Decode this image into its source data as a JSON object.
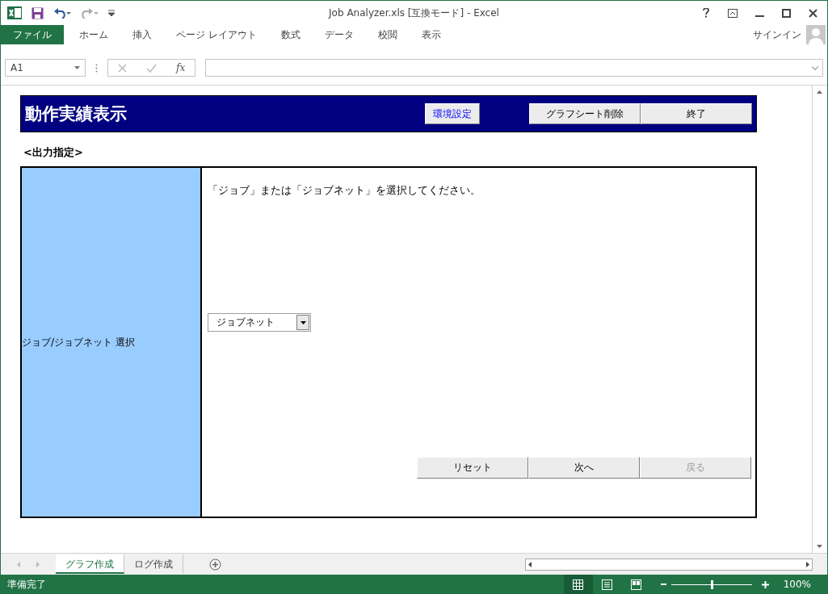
{
  "window": {
    "title": "Job Analyzer.xls  [互換モード] - Excel"
  },
  "ribbon_tabs": [
    {
      "label": "ファイル",
      "kind": "file",
      "selected": false
    },
    {
      "label": "ホーム",
      "kind": "tab",
      "selected": false
    },
    {
      "label": "挿入",
      "kind": "tab",
      "selected": false
    },
    {
      "label": "ページ レイアウト",
      "kind": "tab",
      "selected": false
    },
    {
      "label": "数式",
      "kind": "tab",
      "selected": false
    },
    {
      "label": "データ",
      "kind": "tab",
      "selected": false
    },
    {
      "label": "校閲",
      "kind": "tab",
      "selected": false
    },
    {
      "label": "表示",
      "kind": "tab",
      "selected": false
    }
  ],
  "account": {
    "label": "サインイン"
  },
  "formula_bar": {
    "name_box": "A1",
    "function_label": "fx"
  },
  "sheet": {
    "header": {
      "title": "動作実績表示",
      "buttons": [
        {
          "label": "環境設定",
          "kind": "link"
        },
        {
          "label": "グラフシート削除",
          "kind": "plain"
        },
        {
          "label": "終了",
          "kind": "plain"
        }
      ]
    },
    "section_label": "<出力指定>",
    "form": {
      "row_label": "ジョブ/ジョブネット  選択",
      "instruction": "「ジョブ」または「ジョブネット」を選択してください。",
      "dropdown": {
        "value": "ジョブネット"
      },
      "buttons": [
        {
          "label": "リセット",
          "disabled": false
        },
        {
          "label": "次へ",
          "disabled": false
        },
        {
          "label": "戻る",
          "disabled": true
        }
      ]
    }
  },
  "sheet_tabs": [
    {
      "label": "グラフ作成",
      "selected": true
    },
    {
      "label": "ログ作成",
      "selected": false
    }
  ],
  "status_bar": {
    "status": "準備完了",
    "views": [
      {
        "kind": "normal",
        "selected": true
      },
      {
        "kind": "page",
        "selected": false
      },
      {
        "kind": "break",
        "selected": false
      }
    ],
    "zoom": {
      "level": 0.5,
      "reading": "100%"
    }
  }
}
